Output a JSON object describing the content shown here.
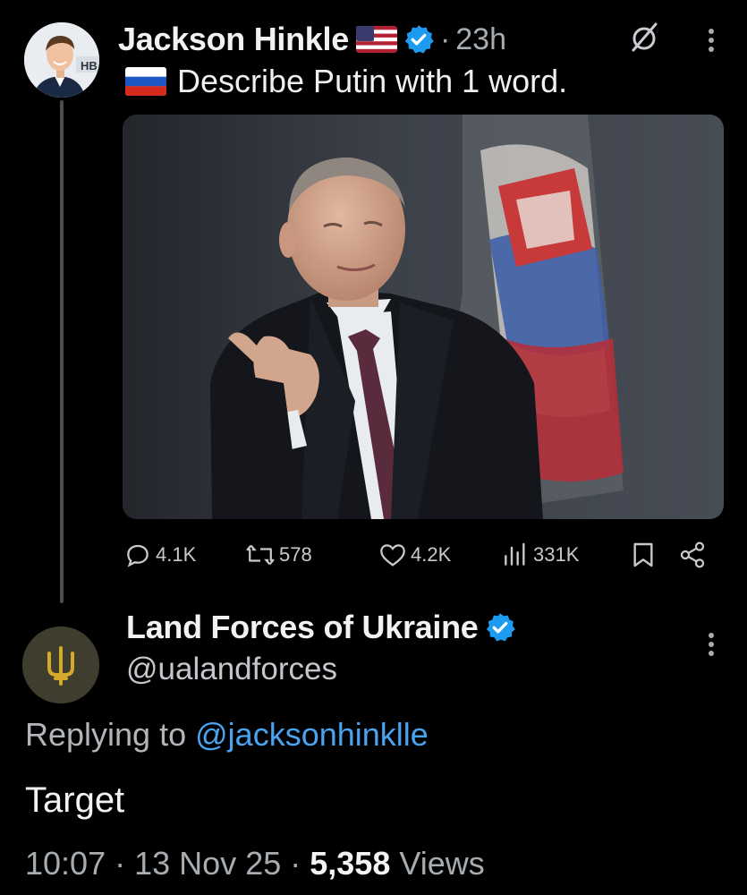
{
  "tweet": {
    "author_name": "Jackson Hinkle",
    "separator": "·",
    "time_ago": "23h",
    "text": "Describe Putin with 1 word.",
    "avatar_logo_text": "HB",
    "stats": {
      "replies": "4.1K",
      "reposts": "578",
      "likes": "4.2K",
      "views": "331K"
    }
  },
  "reply": {
    "author_name": "Land Forces of Ukraine",
    "handle": "@ualandforces",
    "replying_prefix": "Replying to",
    "replying_mention": "@jacksonhinklle",
    "text": "Target",
    "time": "10:07",
    "separator": "·",
    "date": "13 Nov 25",
    "views_count": "5,358",
    "views_label": "Views"
  },
  "colors": {
    "background": "#000000",
    "verified_blue": "#1d9bf0",
    "mention_blue": "#4aa3f0",
    "secondary_text": "#a7acb1",
    "trident_gold": "#d5a92b"
  },
  "icons": [
    "us-flag-icon",
    "verified-badge-icon",
    "grok-icon",
    "more-options-icon",
    "russia-flag-icon",
    "reply-icon",
    "repost-icon",
    "like-icon",
    "views-icon",
    "bookmark-icon",
    "share-icon",
    "trident-icon"
  ]
}
